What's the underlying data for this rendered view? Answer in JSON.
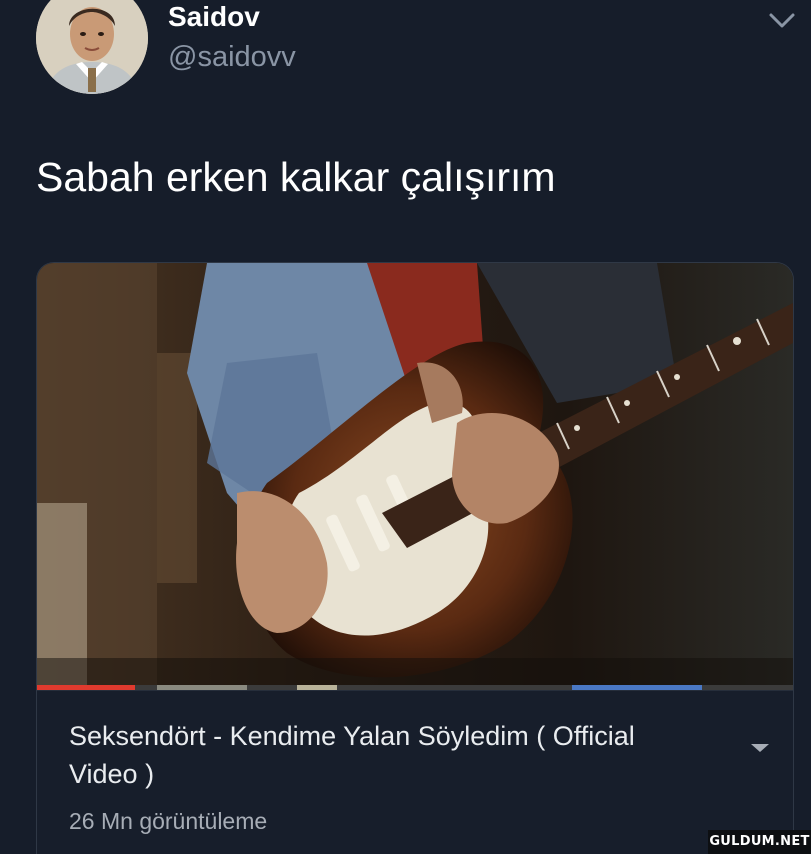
{
  "user": {
    "display_name": "Saidov",
    "handle": "@saidovv",
    "avatar_icon": "profile-photo"
  },
  "tweet": {
    "text": "Sabah erken kalkar çalışırım"
  },
  "video_card": {
    "title": "Seksendört - Kendime Yalan Söyledim ( Official Video )",
    "views": "26 Mn görüntüleme",
    "progress_played": 0.13,
    "thumbnail_icon": "guitar-video-thumbnail",
    "dropdown_icon": "caret-down-icon"
  },
  "menu": {
    "icon": "chevron-down-icon"
  },
  "watermark": "GULDUM.NET",
  "colors": {
    "background": "#161d2a",
    "text": "#ffffff",
    "muted": "#8a95a5",
    "progress": "#e03a2e"
  }
}
